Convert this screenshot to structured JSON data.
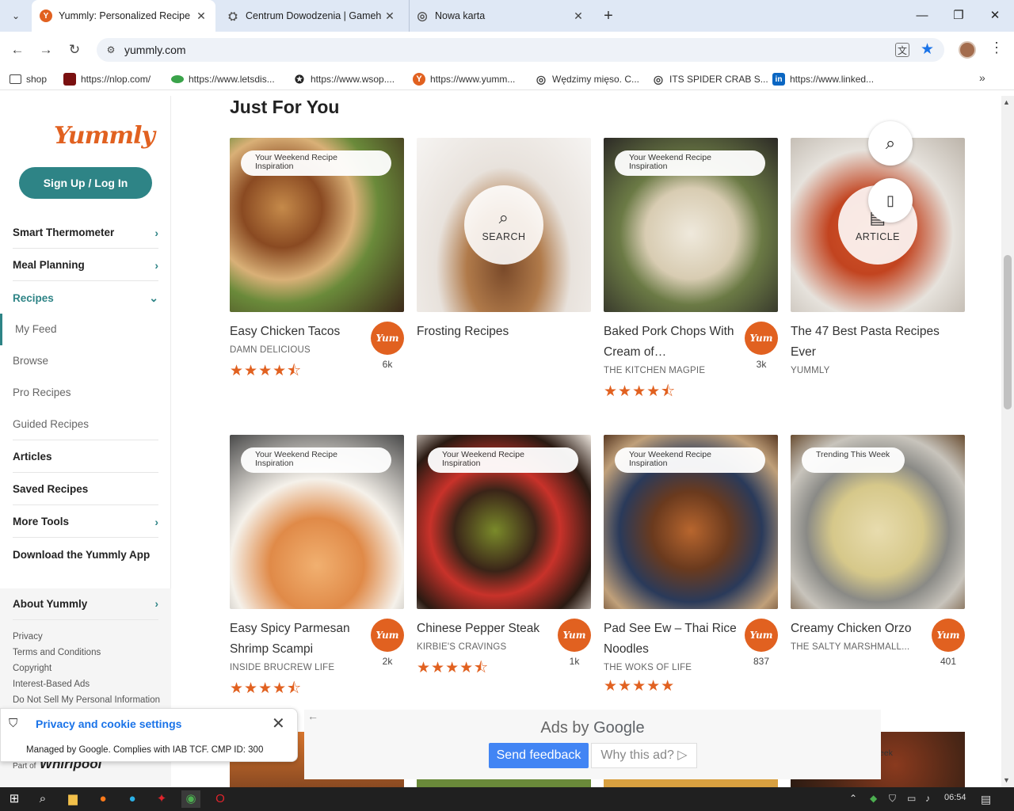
{
  "browser": {
    "tabs": [
      {
        "title": "Yummly: Personalized Recipe R",
        "fav": "Y",
        "fav_color": "#e16120"
      },
      {
        "title": "Centrum Dowodzenia | Gameh",
        "fav": "⛭",
        "fav_color": "#555555"
      },
      {
        "title": "Nowa karta",
        "fav": "◎",
        "fav_color": "#555555"
      }
    ],
    "url": "yummly.com",
    "bookmarks": [
      {
        "label": "shop",
        "icon": "folder-icon"
      },
      {
        "label": "https://nlop.com/",
        "icon": "nlop-icon"
      },
      {
        "label": "https://www.letsdis...",
        "icon": "letsdis-icon"
      },
      {
        "label": "https://www.wsop....",
        "icon": "wsop-icon"
      },
      {
        "label": "https://www.yumm...",
        "icon": "yummly-icon"
      },
      {
        "label": "Wędzimy mięso. C...",
        "icon": "globe-icon"
      },
      {
        "label": "ITS SPIDER CRAB S...",
        "icon": "globe-icon"
      },
      {
        "label": "https://www.linked...",
        "icon": "linkedin-icon"
      }
    ]
  },
  "sidebar": {
    "logo": "Yummly",
    "signup": "Sign Up / Log In",
    "items": [
      {
        "label": "Smart Thermometer",
        "chevron": "›"
      },
      {
        "label": "Meal Planning",
        "chevron": "›"
      },
      {
        "label": "Recipes",
        "chevron": "⌄"
      }
    ],
    "subitems": [
      "My Feed",
      "Browse",
      "Pro Recipes",
      "Guided Recipes"
    ],
    "items2": [
      "Articles",
      "Saved Recipes",
      "More Tools",
      "Download the Yummly App"
    ],
    "about": "About Yummly",
    "footer": [
      "Privacy",
      "Terms and Conditions",
      "Copyright",
      "Interest-Based Ads",
      "Do Not Sell My Personal Information"
    ],
    "part_of": "Part of",
    "brand": "Whirlpool"
  },
  "main": {
    "heading": "Just For You",
    "row1": [
      {
        "badge": "Your Weekend Recipe Inspiration",
        "title": "Easy Chicken Tacos",
        "source": "DAMN DELICIOUS",
        "stars": "★★★★⯪",
        "yum": "Yum",
        "count": "6k"
      },
      {
        "overlay": "SEARCH",
        "title": "Frosting Recipes"
      },
      {
        "badge": "Your Weekend Recipe Inspiration",
        "title": "Baked Pork Chops With Cream of…",
        "source": "THE KITCHEN MAGPIE",
        "stars": "★★★★⯪",
        "yum": "Yum",
        "count": "3k"
      },
      {
        "overlay": "ARTICLE",
        "title": "The 47 Best Pasta Recipes Ever",
        "source": "YUMMLY"
      }
    ],
    "row2": [
      {
        "badge": "Your Weekend Recipe Inspiration",
        "title": "Easy Spicy Parmesan Shrimp Scampi",
        "source": "INSIDE BRUCREW LIFE",
        "stars": "★★★★⯪",
        "yum": "Yum",
        "count": "2k"
      },
      {
        "badge": "Your Weekend Recipe Inspiration",
        "title": "Chinese Pepper Steak",
        "source": "KIRBIE'S CRAVINGS",
        "stars": "★★★★⯪",
        "yum": "Yum",
        "count": "1k"
      },
      {
        "badge": "Your Weekend Recipe Inspiration",
        "title": "Pad See Ew – Thai Rice Noodles",
        "source": "THE WOKS OF LIFE",
        "stars": "★★★★★",
        "yum": "Yum",
        "count": "837"
      },
      {
        "badge": "Trending This Week",
        "title": "Creamy Chicken Orzo",
        "source": "THE SALTY MARSHMALL...",
        "yum": "Yum",
        "count": "401"
      }
    ],
    "row3_badge": "eek"
  },
  "ads": {
    "by_prefix": "Ads by ",
    "by_brand": "Google",
    "send_feedback": "Send feedback",
    "why": "Why this ad? ▷"
  },
  "privacy": {
    "title": "Privacy and cookie settings",
    "managed": "Managed by Google. Complies with IAB TCF. CMP ID: 300"
  },
  "taskbar": {
    "time": "06:54"
  },
  "colors": {
    "brand": "#e16120",
    "teal": "#2e8486"
  }
}
